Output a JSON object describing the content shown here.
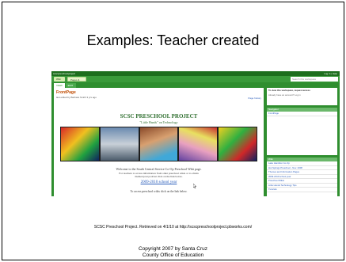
{
  "slide": {
    "title": "Examples: Teacher created",
    "citation": "SCSC Preschool Project. Retrieved on 4/1/10 at http://scscpreschoolproject.pbworks.com/",
    "copyright_line1": "Copyright 2007 by Santa Cruz",
    "copyright_line2": "County Office of Education"
  },
  "screenshot": {
    "site_name": "scscpreschoolproject",
    "help_link": "Log in | Help",
    "nav_wiki": "Wiki",
    "nav_pages": "Pages & Files",
    "search_placeholder": "Search this workspace",
    "tabs": [
      "VIEW",
      "EDIT"
    ],
    "page_name": "FrontPage",
    "page_meta": "last edited by Barbara Smith  3 yrs ago",
    "page_history": "Page history",
    "project_title": "SCSC PRESCHOOL PROJECT",
    "project_subtitle": "\"Little Hands\" on Technology",
    "welcome": "Welcome to the South Central Service Co-Op Preschool Wiki page.",
    "welcome_detail_1": "For teachers to access information from other preschool wikis or to obtain",
    "welcome_detail_2": "themes/post podcast click on the link below.",
    "year_link": "2009-2010 school year",
    "access_text": "To access preschool wikis click on the link below.",
    "sidebar": {
      "access_text": "To view this workspace, request access",
      "access_note": "Already have an account? Log in",
      "navigator_title": "Navigator",
      "navigator_items": [
        "FrontPage"
      ],
      "wiki_title": "Wiki",
      "wiki_items": [
        "Lake Hamilton Co-Op",
        "Hot Springs Preschool - Nov. 2008",
        "Themes and Information Pages",
        "2009-2010 school year",
        "Preschool Wikis",
        "Little Hands Technology Tips",
        "Tutorials"
      ]
    }
  }
}
